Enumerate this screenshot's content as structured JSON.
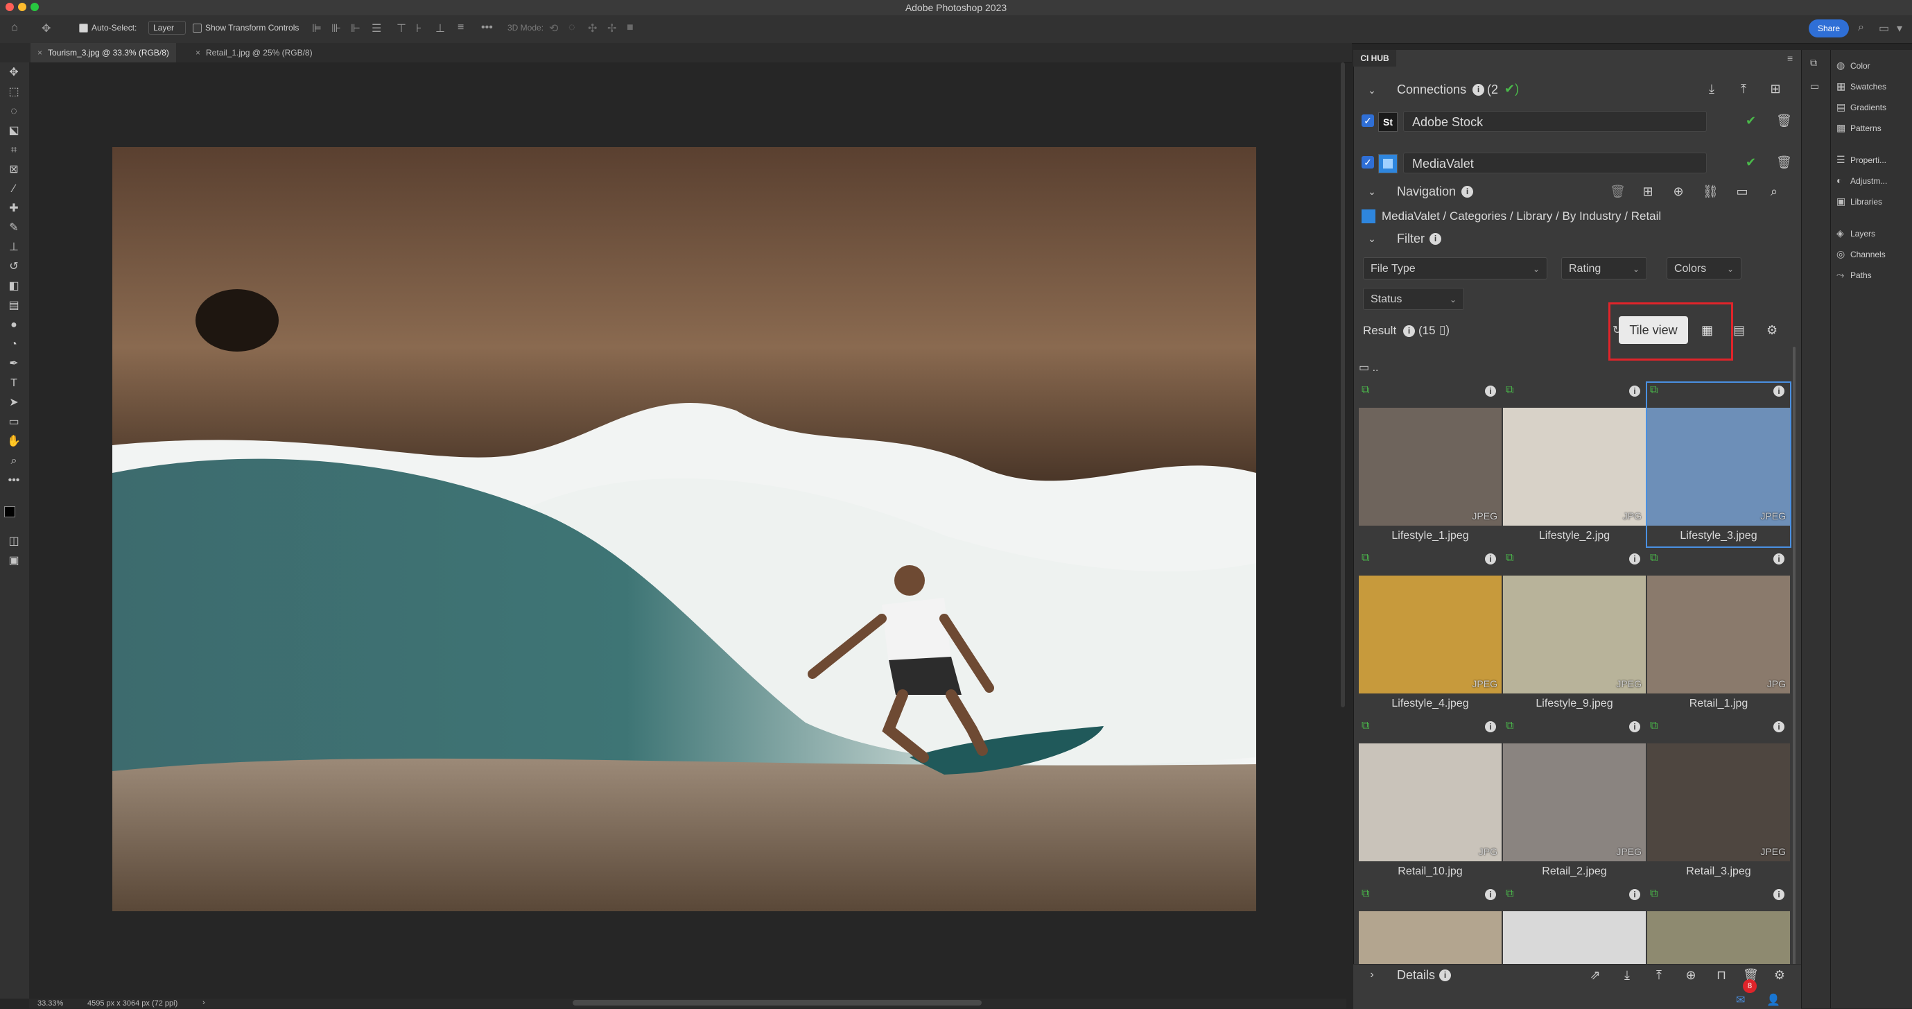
{
  "window": {
    "title": "Adobe Photoshop 2023"
  },
  "options_bar": {
    "auto_select_label": "Auto-Select:",
    "auto_select_value": "Layer",
    "show_transform_label": "Show Transform Controls",
    "mode_label": "3D Mode:",
    "share_label": "Share"
  },
  "tabs": [
    {
      "label": "Tourism_3.jpg @ 33.3% (RGB/8)"
    },
    {
      "label": "Retail_1.jpg @ 25% (RGB/8)"
    }
  ],
  "status": {
    "zoom": "33.33%",
    "doc_info": "4595 px x 3064 px (72 ppi)"
  },
  "cihub": {
    "tab_label": "CI HUB",
    "connections_label": "Connections",
    "connections_count": "(2",
    "connections": [
      {
        "badge": "St",
        "name": "Adobe Stock"
      },
      {
        "badge": "",
        "name": "MediaValet"
      }
    ],
    "navigation_label": "Navigation",
    "breadcrumb": [
      "MediaValet",
      "Categories",
      "Library",
      "By Industry",
      "Retail"
    ],
    "filter_label": "Filter",
    "filters": {
      "file_type": "File Type",
      "rating": "Rating",
      "colors": "Colors",
      "status": "Status"
    },
    "result_label": "Result",
    "result_count": "(15",
    "tooltip": "Tile view",
    "parent_folder": "..",
    "details_label": "Details",
    "notification_count": "8",
    "tiles": [
      {
        "name": "Lifestyle_1.jpeg",
        "format": "JPEG",
        "color": "#6e645c"
      },
      {
        "name": "Lifestyle_2.jpg",
        "format": "JPG",
        "color": "#d8d2c8"
      },
      {
        "name": "Lifestyle_3.jpeg",
        "format": "JPEG",
        "color": "#6d8fb8"
      },
      {
        "name": "Lifestyle_4.jpeg",
        "format": "JPEG",
        "color": "#c79a3c"
      },
      {
        "name": "Lifestyle_9.jpeg",
        "format": "JPEG",
        "color": "#b8b39a"
      },
      {
        "name": "Retail_1.jpg",
        "format": "JPG",
        "color": "#8a7a6c"
      },
      {
        "name": "Retail_10.jpg",
        "format": "JPG",
        "color": "#c9c3ba"
      },
      {
        "name": "Retail_2.jpeg",
        "format": "JPEG",
        "color": "#8a8480"
      },
      {
        "name": "Retail_3.jpeg",
        "format": "JPEG",
        "color": "#4e4640"
      },
      {
        "name": "",
        "format": "",
        "color": "#b3a58f"
      },
      {
        "name": "",
        "format": "",
        "color": "#d9d9d9"
      },
      {
        "name": "",
        "format": "",
        "color": "#8e8a70"
      }
    ]
  },
  "dock": [
    {
      "label": "Color",
      "icon": "color-icon"
    },
    {
      "label": "Swatches",
      "icon": "swatches-icon"
    },
    {
      "label": "Gradients",
      "icon": "gradients-icon"
    },
    {
      "label": "Patterns",
      "icon": "patterns-icon"
    },
    {
      "label": "Properti...",
      "icon": "properties-icon"
    },
    {
      "label": "Adjustm...",
      "icon": "adjustments-icon"
    },
    {
      "label": "Libraries",
      "icon": "libraries-icon"
    },
    {
      "label": "Layers",
      "icon": "layers-icon"
    },
    {
      "label": "Channels",
      "icon": "channels-icon"
    },
    {
      "label": "Paths",
      "icon": "paths-icon"
    }
  ],
  "colors": {
    "accent": "#2f6fd6",
    "highlight": "#e0242a",
    "success": "#4ab94a"
  }
}
